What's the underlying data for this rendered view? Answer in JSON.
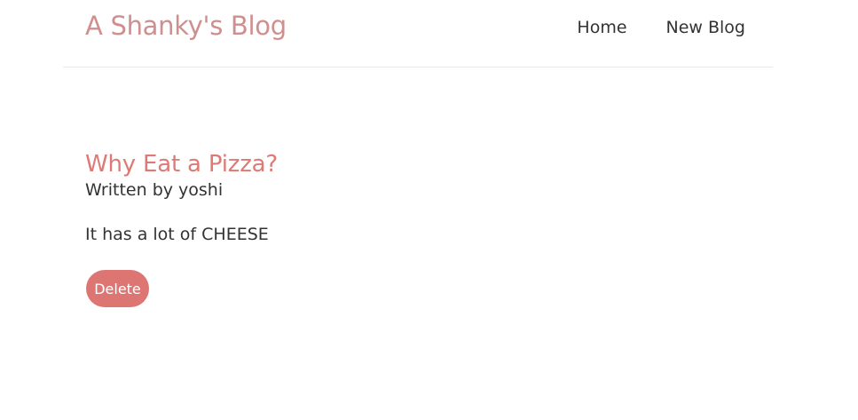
{
  "navbar": {
    "brand": "A Shanky's Blog",
    "links": [
      "Home",
      "New Blog"
    ]
  },
  "blog": {
    "title": "Why Eat a Pizza?",
    "author_line": "Written by yoshi",
    "body": "It has a lot of CHEESE",
    "delete_label": "Delete"
  },
  "colors": {
    "brand": "#cf8f8f",
    "accent": "#dd7672",
    "text": "#333333"
  }
}
